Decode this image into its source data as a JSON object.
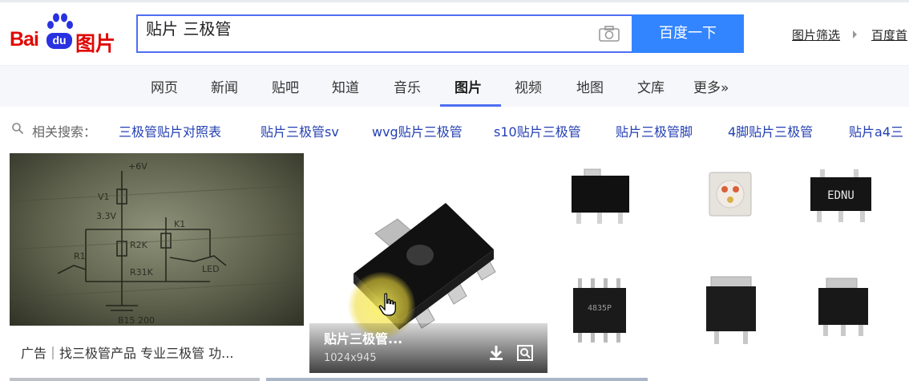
{
  "brand": {
    "bai": "Bai",
    "du": "du",
    "tupian": "图片",
    "colors": {
      "red": "#e10602",
      "blue": "#2932e1"
    }
  },
  "search": {
    "query": "贴片 三极管",
    "button_label": "百度一下"
  },
  "top_links": [
    "图片筛选",
    "百度首"
  ],
  "nav": {
    "items": [
      "网页",
      "新闻",
      "贴吧",
      "知道",
      "音乐",
      "图片",
      "视频",
      "地图",
      "文库",
      "更多»"
    ],
    "active": "图片"
  },
  "related": {
    "label": "相关搜索：",
    "items": [
      "三极管贴片对照表",
      "贴片三极管sv",
      "wvg贴片三极管",
      "s10贴片三极管",
      "贴片三极管脚",
      "4脚贴片三极管",
      "贴片a4三"
    ]
  },
  "results": {
    "ad_caption": "广告｜找三极管产品 专业三极管 功...",
    "main_title": "贴片三极管...",
    "main_size": "1024x945",
    "thumb_labels": [
      "EDNU",
      "4835P"
    ]
  },
  "icons": {
    "camera": "camera-icon",
    "search_glass": "search-icon",
    "download": "download-icon",
    "view": "view-icon",
    "cursor": "hand-cursor-icon"
  }
}
